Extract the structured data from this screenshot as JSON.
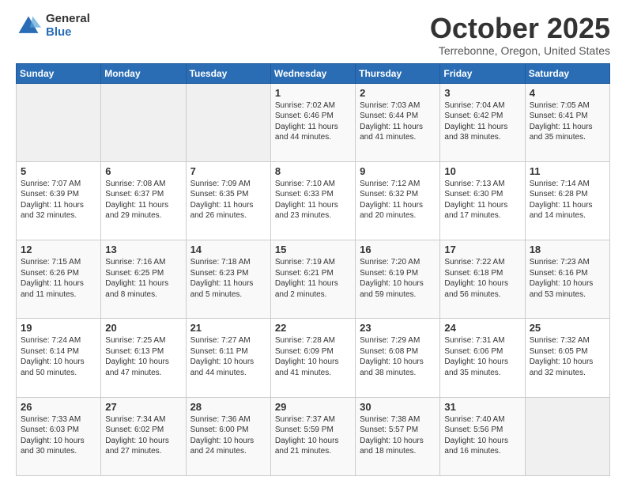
{
  "header": {
    "logo_general": "General",
    "logo_blue": "Blue",
    "title": "October 2025",
    "subtitle": "Terrebonne, Oregon, United States"
  },
  "calendar": {
    "days_of_week": [
      "Sunday",
      "Monday",
      "Tuesday",
      "Wednesday",
      "Thursday",
      "Friday",
      "Saturday"
    ],
    "weeks": [
      [
        {
          "day": "",
          "info": ""
        },
        {
          "day": "",
          "info": ""
        },
        {
          "day": "",
          "info": ""
        },
        {
          "day": "1",
          "info": "Sunrise: 7:02 AM\nSunset: 6:46 PM\nDaylight: 11 hours\nand 44 minutes."
        },
        {
          "day": "2",
          "info": "Sunrise: 7:03 AM\nSunset: 6:44 PM\nDaylight: 11 hours\nand 41 minutes."
        },
        {
          "day": "3",
          "info": "Sunrise: 7:04 AM\nSunset: 6:42 PM\nDaylight: 11 hours\nand 38 minutes."
        },
        {
          "day": "4",
          "info": "Sunrise: 7:05 AM\nSunset: 6:41 PM\nDaylight: 11 hours\nand 35 minutes."
        }
      ],
      [
        {
          "day": "5",
          "info": "Sunrise: 7:07 AM\nSunset: 6:39 PM\nDaylight: 11 hours\nand 32 minutes."
        },
        {
          "day": "6",
          "info": "Sunrise: 7:08 AM\nSunset: 6:37 PM\nDaylight: 11 hours\nand 29 minutes."
        },
        {
          "day": "7",
          "info": "Sunrise: 7:09 AM\nSunset: 6:35 PM\nDaylight: 11 hours\nand 26 minutes."
        },
        {
          "day": "8",
          "info": "Sunrise: 7:10 AM\nSunset: 6:33 PM\nDaylight: 11 hours\nand 23 minutes."
        },
        {
          "day": "9",
          "info": "Sunrise: 7:12 AM\nSunset: 6:32 PM\nDaylight: 11 hours\nand 20 minutes."
        },
        {
          "day": "10",
          "info": "Sunrise: 7:13 AM\nSunset: 6:30 PM\nDaylight: 11 hours\nand 17 minutes."
        },
        {
          "day": "11",
          "info": "Sunrise: 7:14 AM\nSunset: 6:28 PM\nDaylight: 11 hours\nand 14 minutes."
        }
      ],
      [
        {
          "day": "12",
          "info": "Sunrise: 7:15 AM\nSunset: 6:26 PM\nDaylight: 11 hours\nand 11 minutes."
        },
        {
          "day": "13",
          "info": "Sunrise: 7:16 AM\nSunset: 6:25 PM\nDaylight: 11 hours\nand 8 minutes."
        },
        {
          "day": "14",
          "info": "Sunrise: 7:18 AM\nSunset: 6:23 PM\nDaylight: 11 hours\nand 5 minutes."
        },
        {
          "day": "15",
          "info": "Sunrise: 7:19 AM\nSunset: 6:21 PM\nDaylight: 11 hours\nand 2 minutes."
        },
        {
          "day": "16",
          "info": "Sunrise: 7:20 AM\nSunset: 6:19 PM\nDaylight: 10 hours\nand 59 minutes."
        },
        {
          "day": "17",
          "info": "Sunrise: 7:22 AM\nSunset: 6:18 PM\nDaylight: 10 hours\nand 56 minutes."
        },
        {
          "day": "18",
          "info": "Sunrise: 7:23 AM\nSunset: 6:16 PM\nDaylight: 10 hours\nand 53 minutes."
        }
      ],
      [
        {
          "day": "19",
          "info": "Sunrise: 7:24 AM\nSunset: 6:14 PM\nDaylight: 10 hours\nand 50 minutes."
        },
        {
          "day": "20",
          "info": "Sunrise: 7:25 AM\nSunset: 6:13 PM\nDaylight: 10 hours\nand 47 minutes."
        },
        {
          "day": "21",
          "info": "Sunrise: 7:27 AM\nSunset: 6:11 PM\nDaylight: 10 hours\nand 44 minutes."
        },
        {
          "day": "22",
          "info": "Sunrise: 7:28 AM\nSunset: 6:09 PM\nDaylight: 10 hours\nand 41 minutes."
        },
        {
          "day": "23",
          "info": "Sunrise: 7:29 AM\nSunset: 6:08 PM\nDaylight: 10 hours\nand 38 minutes."
        },
        {
          "day": "24",
          "info": "Sunrise: 7:31 AM\nSunset: 6:06 PM\nDaylight: 10 hours\nand 35 minutes."
        },
        {
          "day": "25",
          "info": "Sunrise: 7:32 AM\nSunset: 6:05 PM\nDaylight: 10 hours\nand 32 minutes."
        }
      ],
      [
        {
          "day": "26",
          "info": "Sunrise: 7:33 AM\nSunset: 6:03 PM\nDaylight: 10 hours\nand 30 minutes."
        },
        {
          "day": "27",
          "info": "Sunrise: 7:34 AM\nSunset: 6:02 PM\nDaylight: 10 hours\nand 27 minutes."
        },
        {
          "day": "28",
          "info": "Sunrise: 7:36 AM\nSunset: 6:00 PM\nDaylight: 10 hours\nand 24 minutes."
        },
        {
          "day": "29",
          "info": "Sunrise: 7:37 AM\nSunset: 5:59 PM\nDaylight: 10 hours\nand 21 minutes."
        },
        {
          "day": "30",
          "info": "Sunrise: 7:38 AM\nSunset: 5:57 PM\nDaylight: 10 hours\nand 18 minutes."
        },
        {
          "day": "31",
          "info": "Sunrise: 7:40 AM\nSunset: 5:56 PM\nDaylight: 10 hours\nand 16 minutes."
        },
        {
          "day": "",
          "info": ""
        }
      ]
    ]
  }
}
